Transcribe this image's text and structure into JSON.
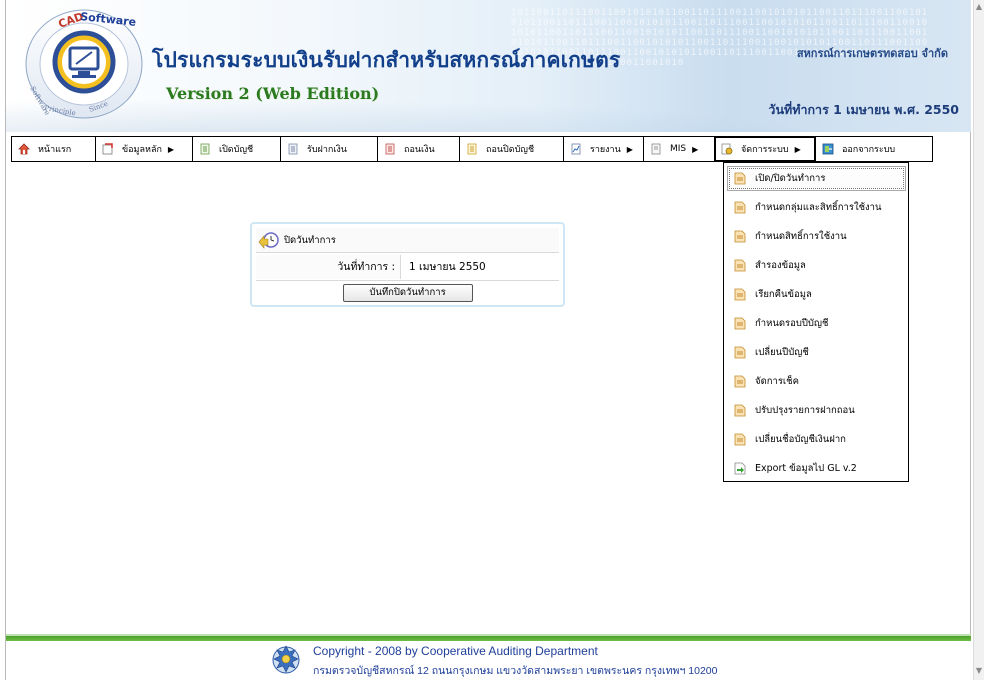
{
  "header": {
    "logo_text": "CAD Software Center",
    "app_title": "โปรแกรมระบบเงินรับฝากสำหรับสหกรณ์ภาคเกษตร",
    "version": "Version 2 (Web Edition)",
    "org_name": "สหกรณ์การเกษตรทดสอบ จำกัด",
    "work_date": "วันที่ทำการ 1 เมษายน พ.ศ. 2550"
  },
  "menu": {
    "items": [
      {
        "label": "หน้าแรก",
        "icon": "home-icon",
        "submenu": false
      },
      {
        "label": "ข้อมูลหลัก",
        "icon": "folder-icon",
        "submenu": true
      },
      {
        "label": "เปิดบัญชี",
        "icon": "document-icon",
        "submenu": false
      },
      {
        "label": "รับฝากเงิน",
        "icon": "document-icon",
        "submenu": false
      },
      {
        "label": "ถอนเงิน",
        "icon": "document-icon",
        "submenu": false
      },
      {
        "label": "ถอนปิดบัญชี",
        "icon": "document-icon",
        "submenu": false
      },
      {
        "label": "รายงาน",
        "icon": "report-icon",
        "submenu": true
      },
      {
        "label": "MIS",
        "icon": "page-icon",
        "submenu": true
      },
      {
        "label": "จัดการระบบ",
        "icon": "settings-page-icon",
        "submenu": true
      },
      {
        "label": "ออกจากระบบ",
        "icon": "exit-icon",
        "submenu": false
      }
    ]
  },
  "dropdown": {
    "items": [
      {
        "label": "เปิด/ปิดวันทำการ"
      },
      {
        "label": "กำหนดกลุ่มและสิทธิ์การใช้งาน"
      },
      {
        "label": "กำหนดสิทธิ์การใช้งาน"
      },
      {
        "label": "สำรองข้อมูล"
      },
      {
        "label": "เรียกคืนข้อมูล"
      },
      {
        "label": "กำหนดรอบปีบัญชี"
      },
      {
        "label": "เปลี่ยนปีบัญชี"
      },
      {
        "label": "จัดการเช็ค"
      },
      {
        "label": "ปรับปรุงรายการฝากถอน"
      },
      {
        "label": "เปลี่ยนชื่อบัญชีเงินฝาก"
      },
      {
        "label": "Export ข้อมูลไป GL v.2"
      }
    ],
    "selected_index": 0
  },
  "panel": {
    "title": "ปิดวันทำการ",
    "date_label": "วันที่ทำการ :",
    "date_value": "1 เมษายน 2550",
    "button_label": "บันทึกปิดวันทำการ"
  },
  "footer": {
    "copyright": "Copyright - 2008 by Cooperative Auditing Department",
    "address": "กรมตรวจบัญชีสหกรณ์ 12 ถนนกรุงเกษม แขวงวัดสามพระยา เขตพระนคร กรุงเทพฯ 10200"
  },
  "colors": {
    "title_blue": "#123f8a",
    "version_green": "#2b7a1f",
    "footer_green": "#4aa02c",
    "link_blue": "#1f3f99"
  }
}
